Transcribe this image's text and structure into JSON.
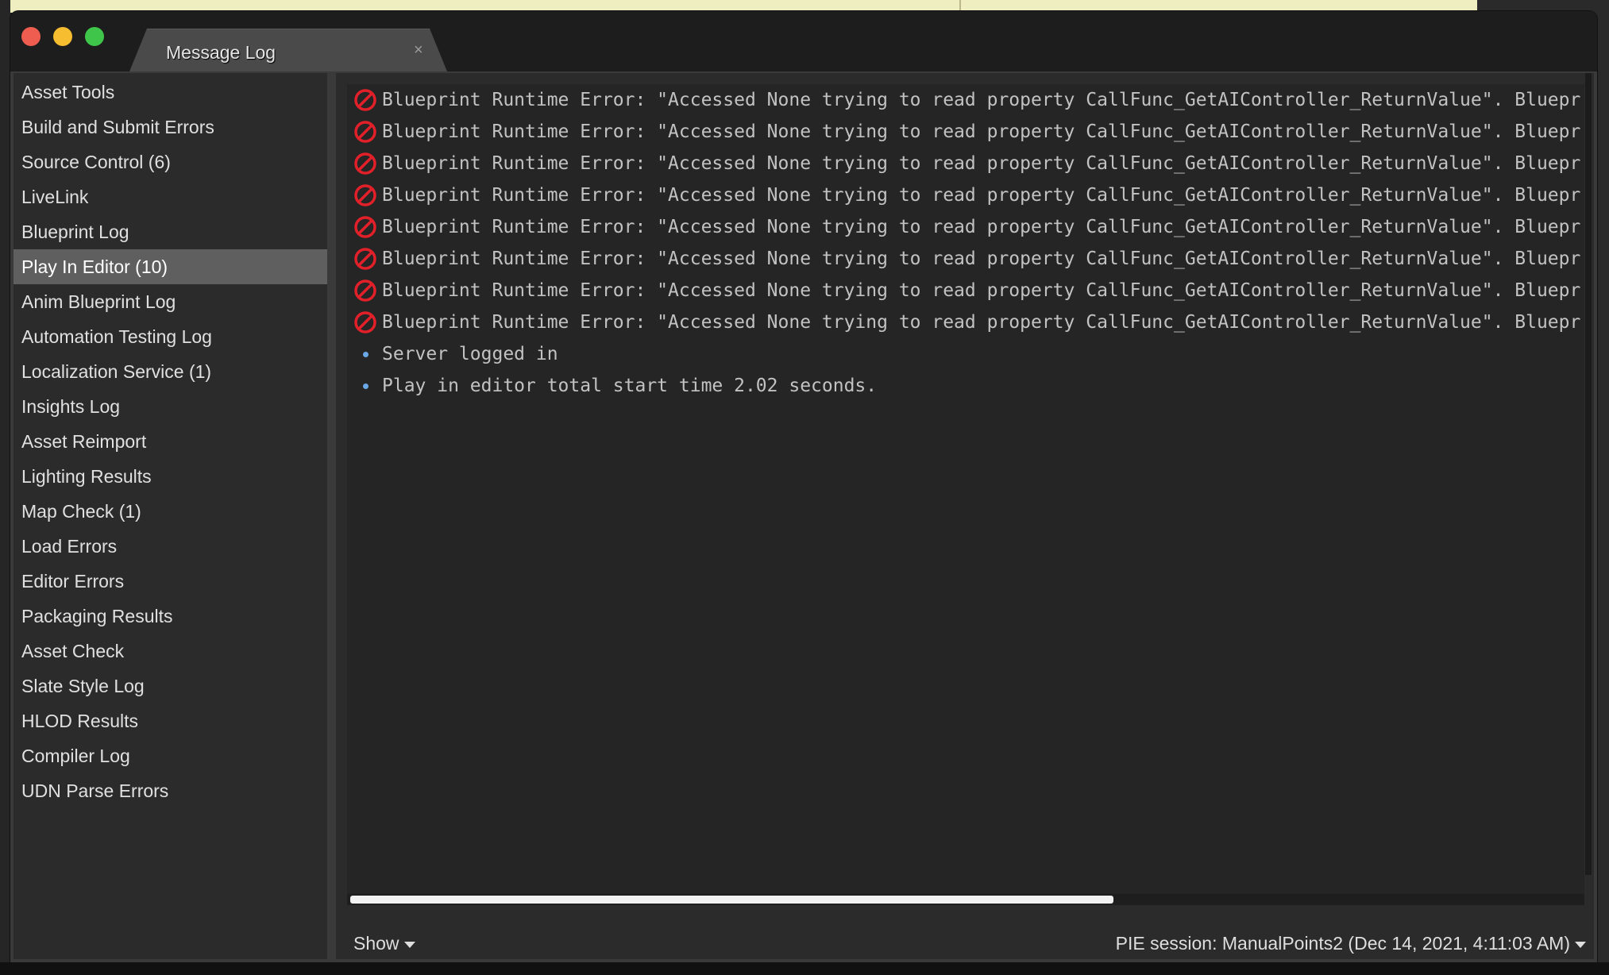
{
  "window": {
    "tab_title": "Message Log",
    "tab_close_glyph": "×"
  },
  "sidebar": {
    "selected_index": 5,
    "items": [
      {
        "label": "Asset Tools"
      },
      {
        "label": "Build and Submit Errors"
      },
      {
        "label": "Source Control (6)"
      },
      {
        "label": "LiveLink"
      },
      {
        "label": "Blueprint Log"
      },
      {
        "label": "Play In Editor (10)"
      },
      {
        "label": "Anim Blueprint Log"
      },
      {
        "label": "Automation Testing Log"
      },
      {
        "label": "Localization Service (1)"
      },
      {
        "label": "Insights Log"
      },
      {
        "label": "Asset Reimport"
      },
      {
        "label": "Lighting Results"
      },
      {
        "label": "Map Check (1)"
      },
      {
        "label": "Load Errors"
      },
      {
        "label": "Editor Errors"
      },
      {
        "label": "Packaging Results"
      },
      {
        "label": "Asset Check"
      },
      {
        "label": "Slate Style Log"
      },
      {
        "label": "HLOD Results"
      },
      {
        "label": "Compiler Log"
      },
      {
        "label": "UDN Parse Errors"
      }
    ]
  },
  "log": {
    "messages": [
      {
        "severity": "error",
        "text": "Blueprint Runtime Error: \"Accessed None trying to read property CallFunc_GetAIController_ReturnValue\". Bluepr"
      },
      {
        "severity": "error",
        "text": "Blueprint Runtime Error: \"Accessed None trying to read property CallFunc_GetAIController_ReturnValue\". Bluepr"
      },
      {
        "severity": "error",
        "text": "Blueprint Runtime Error: \"Accessed None trying to read property CallFunc_GetAIController_ReturnValue\". Bluepr"
      },
      {
        "severity": "error",
        "text": "Blueprint Runtime Error: \"Accessed None trying to read property CallFunc_GetAIController_ReturnValue\". Bluepr"
      },
      {
        "severity": "error",
        "text": "Blueprint Runtime Error: \"Accessed None trying to read property CallFunc_GetAIController_ReturnValue\". Bluepr"
      },
      {
        "severity": "error",
        "text": "Blueprint Runtime Error: \"Accessed None trying to read property CallFunc_GetAIController_ReturnValue\". Bluepr"
      },
      {
        "severity": "error",
        "text": "Blueprint Runtime Error: \"Accessed None trying to read property CallFunc_GetAIController_ReturnValue\". Bluepr"
      },
      {
        "severity": "error",
        "text": "Blueprint Runtime Error: \"Accessed None trying to read property CallFunc_GetAIController_ReturnValue\". Bluepr"
      },
      {
        "severity": "info",
        "text": "Server logged in"
      },
      {
        "severity": "info",
        "text": "Play in editor total start time 2.02 seconds."
      }
    ],
    "horizontal_scroll_fraction": 0.62
  },
  "footer": {
    "show_label": "Show",
    "session_label": "PIE session: ManualPoints2 (Dec 14, 2021, 4:11:03 AM)"
  },
  "colors": {
    "error_icon": "#e2202a",
    "info_dot": "#6aa9e6",
    "selected_item_bg": "#5f5f5f"
  },
  "icons": {
    "error": "no-entry-icon",
    "info": "info-dot-icon",
    "dropdown": "caret-down-icon"
  }
}
